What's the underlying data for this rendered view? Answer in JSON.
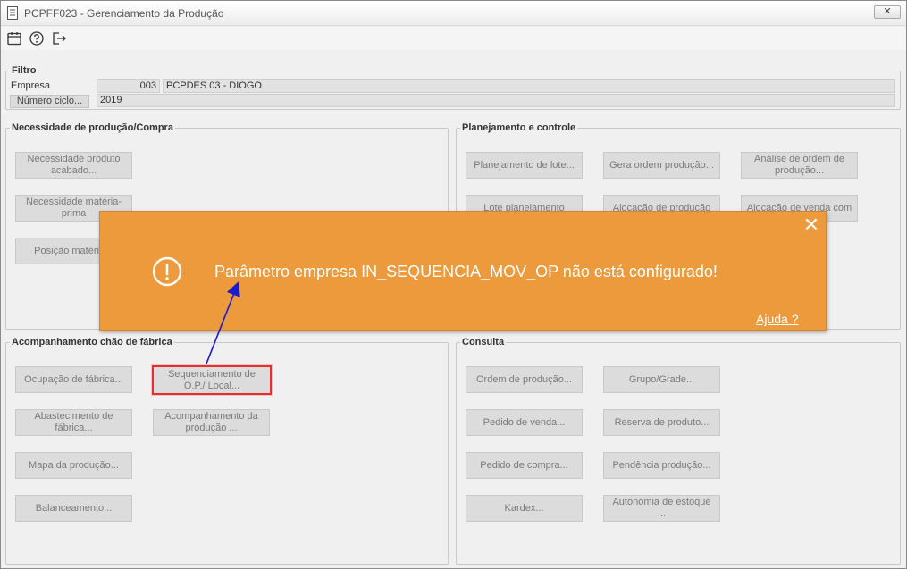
{
  "window": {
    "title": "PCPFF023 - Gerenciamento da Produção",
    "close_label": "✕"
  },
  "toolbar": {
    "icons": [
      "calendar-icon",
      "help-icon",
      "exit-icon"
    ]
  },
  "filtro": {
    "legend": "Filtro",
    "empresa_label": "Empresa",
    "empresa_code": "003",
    "empresa_name": "PCPDES 03 - DIOGO",
    "ciclo_button": "Número ciclo...",
    "ciclo_value": "2019"
  },
  "necessidade": {
    "legend": "Necessidade de produção/Compra",
    "buttons": [
      "Necessidade produto acabado...",
      "Necessidade matéria-prima",
      "Posição matéria-p"
    ]
  },
  "planejamento": {
    "legend": "Planejamento e controle",
    "buttons": [
      "Planejamento de lote...",
      "Gera ordem produção...",
      "Análise de ordem de produção...",
      "Lote planejamento",
      "Alocação de produção",
      "Alocação de venda com"
    ]
  },
  "acompanhamento": {
    "legend": "Acompanhamento chão de fábrica",
    "buttons": [
      "Ocupação de fábrica...",
      "Sequenciamento de O.P./ Local...",
      "Abastecimento de fábrica...",
      "Acompanhamento da produção ...",
      "Mapa da produção...",
      "Balanceamento..."
    ]
  },
  "consulta": {
    "legend": "Consulta",
    "buttons": [
      "Ordem de produção...",
      "Grupo/Grade...",
      "Pedido de venda...",
      "Reserva de produto...",
      "Pedido de compra...",
      "Pendência produção...",
      "Kardex...",
      "Autonomia de estoque ..."
    ]
  },
  "toast": {
    "icon": "alert-circle-icon",
    "message": "Parâmetro empresa IN_SEQUENCIA_MOV_OP não está configurado!",
    "help_link": "Ajuda ?",
    "close": "✕",
    "background": "#ec9a3c"
  },
  "highlight_color": "#e03030",
  "arrow_color": "#1a1ad0"
}
